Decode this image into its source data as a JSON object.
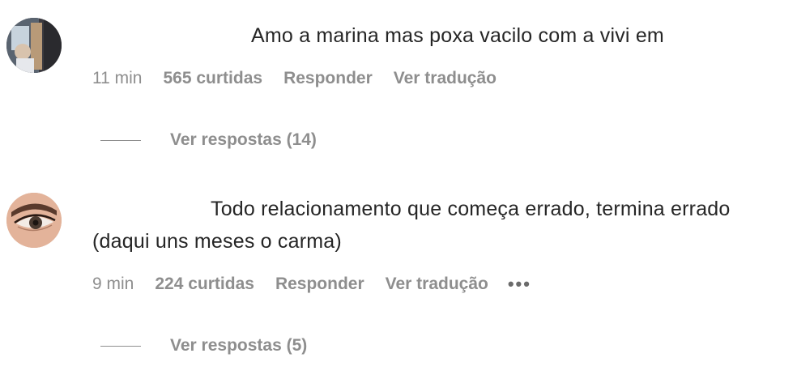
{
  "comments": [
    {
      "text": "Amo a marina mas poxa vacilo com a vivi em",
      "time": "11 min",
      "likes": "565 curtidas",
      "reply": "Responder",
      "translate": "Ver tradução",
      "view_replies": "Ver respostas (14)",
      "show_more": false
    },
    {
      "text": "Todo relacionamento que começa errado, termina errado (daqui uns meses o carma)",
      "time": "9 min",
      "likes": "224 curtidas",
      "reply": "Responder",
      "translate": "Ver tradução",
      "more_icon": "•••",
      "view_replies": "Ver respostas (5)",
      "show_more": true
    }
  ]
}
